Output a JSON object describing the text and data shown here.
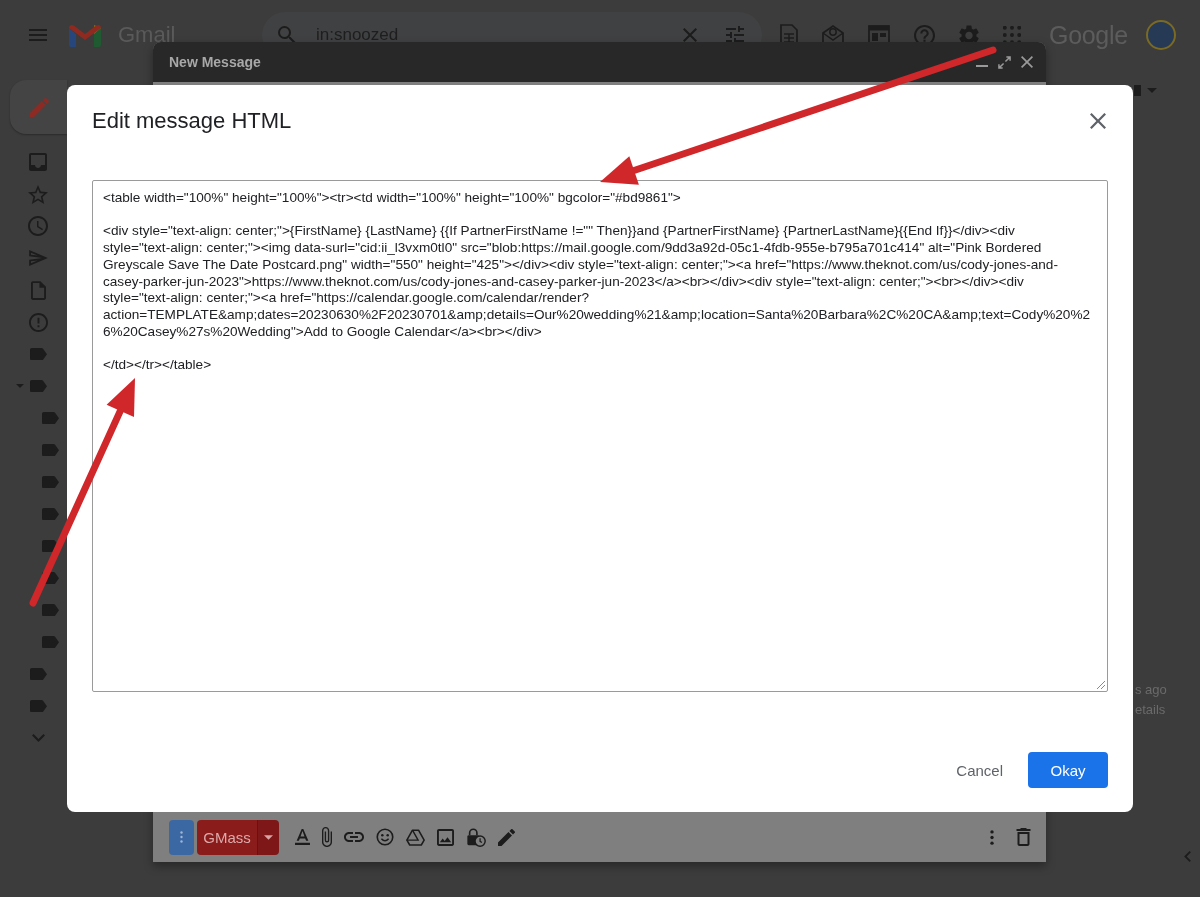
{
  "topbar": {
    "app_name": "Gmail",
    "search": {
      "value": "in:snoozed"
    },
    "logo_text": "Google"
  },
  "compose": {
    "title": "New Message",
    "send_button": {
      "label": "GMass"
    }
  },
  "dialog": {
    "title": "Edit message HTML",
    "editor": {
      "paragraphs": [
        {
          "lines": [
            "<table width=\"100%\" height=\"100%\"><tr><td width=\"100%\" height=\"100%\" bgcolor=\"#bd9861\">"
          ]
        },
        {
          "lines": [
            "<div style=\"text-align: center;\">{FirstName} {LastName} {{If PartnerFirstName !=\"\" Then}}and {PartnerFirstName} {PartnerLastName}{{End If}}</div><div",
            "style=\"text-align: center;\"><img data-surl=\"cid:ii_l3vxm0tl0\" src=\"blob:https://mail.google.com/9dd3a92d-05c1-4fdb-955e-b795a701c414\" alt=\"Pink Bordered",
            "Greyscale Save The Date Postcard.png\" width=\"550\" height=\"425\"></div><div style=\"text-align: center;\"><a href=\"https://www.theknot.com/us/cody-jones-and-",
            "casey-parker-jun-2023\">https://www.theknot.com/us/cody-jones-and-casey-parker-jun-2023</a><br></div><div style=\"text-align: center;\"><br></div><div",
            "style=\"text-align: center;\"><a href=\"https://calendar.google.com/calendar/render?",
            "action=TEMPLATE&amp;dates=20230630%2F20230701&amp;details=Our%20wedding%21&amp;location=Santa%20Barbara%2C%20CA&amp;text=Cody%20%2",
            "6%20Casey%27s%20Wedding\">Add to Google Calendar</a><br></div>"
          ]
        },
        {
          "lines": [
            "</td></tr></table>"
          ]
        }
      ]
    },
    "buttons": [
      {
        "label": "Cancel",
        "kind": "text"
      },
      {
        "label": "Okay",
        "kind": "primary"
      }
    ]
  },
  "mail_list": {
    "fragments": [
      "s ago",
      "etails"
    ]
  }
}
